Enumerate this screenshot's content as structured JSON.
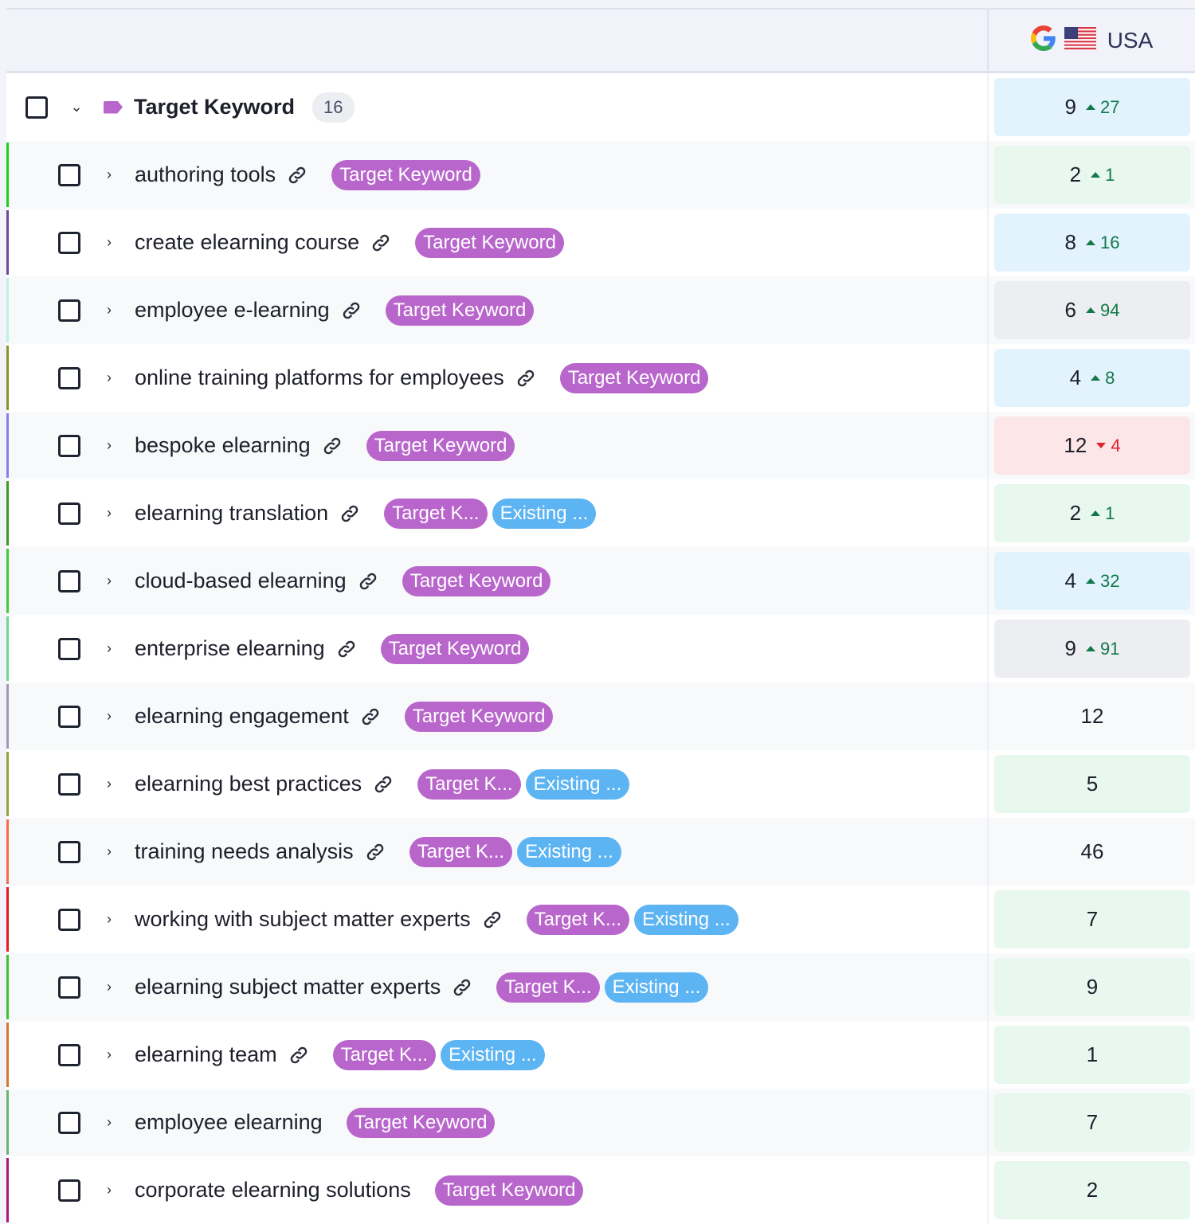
{
  "header": {
    "search_engine_icon": "google-icon",
    "flag_icon": "us-flag-icon",
    "region_label": "USA"
  },
  "group": {
    "name": "Target Keyword",
    "count": "16",
    "position": "9",
    "change": "27",
    "direction": "up",
    "cell_color": "#e3f3fd"
  },
  "colors": {
    "tag_target": "#b866cb",
    "tag_existing": "#5db4f3",
    "up": "#12794a",
    "down": "#e0212b",
    "cell_blue": "#e3f3fd",
    "cell_green": "#e8f8ee",
    "cell_gray": "#eceef1",
    "cell_red": "#fde6e7"
  },
  "rows": [
    {
      "keyword": "authoring tools",
      "link": true,
      "tags": [
        "Target Keyword"
      ],
      "position": "2",
      "change": "1",
      "direction": "up",
      "cell": "#e8f8ee",
      "stripe": "#1bd11b"
    },
    {
      "keyword": "create elearning course",
      "link": true,
      "tags": [
        "Target Keyword"
      ],
      "position": "8",
      "change": "16",
      "direction": "up",
      "cell": "#e3f3fd",
      "stripe": "#6d4a9c"
    },
    {
      "keyword": "employee e-learning",
      "link": true,
      "tags": [
        "Target Keyword"
      ],
      "position": "6",
      "change": "94",
      "direction": "up",
      "cell": "#eceef1",
      "stripe": "#b9f5de"
    },
    {
      "keyword": "online training platforms for employees",
      "link": true,
      "tags": [
        "Target Keyword"
      ],
      "position": "4",
      "change": "8",
      "direction": "up",
      "cell": "#e3f3fd",
      "stripe": "#8a9427"
    },
    {
      "keyword": "bespoke elearning",
      "link": true,
      "tags": [
        "Target Keyword"
      ],
      "position": "12",
      "change": "4",
      "direction": "down",
      "cell": "#fde6e7",
      "stripe": "#8e7af0"
    },
    {
      "keyword": "elearning translation",
      "link": true,
      "tags": [
        "Target K...",
        "Existing ..."
      ],
      "position": "2",
      "change": "1",
      "direction": "up",
      "cell": "#e8f8ee",
      "stripe": "#3f9a1e"
    },
    {
      "keyword": "cloud-based elearning",
      "link": true,
      "tags": [
        "Target Keyword"
      ],
      "position": "4",
      "change": "32",
      "direction": "up",
      "cell": "#e3f3fd",
      "stripe": "#3ccc3c"
    },
    {
      "keyword": "enterprise elearning",
      "link": true,
      "tags": [
        "Target Keyword"
      ],
      "position": "9",
      "change": "91",
      "direction": "up",
      "cell": "#eceef1",
      "stripe": "#6fd98a"
    },
    {
      "keyword": "elearning engagement",
      "link": true,
      "tags": [
        "Target Keyword"
      ],
      "position": "12",
      "change": "",
      "direction": "",
      "cell": "",
      "stripe": "#a298b4"
    },
    {
      "keyword": "elearning best practices",
      "link": true,
      "tags": [
        "Target K...",
        "Existing ..."
      ],
      "position": "5",
      "change": "",
      "direction": "",
      "cell": "#e8f8ee",
      "stripe": "#8fa638"
    },
    {
      "keyword": "training needs analysis",
      "link": true,
      "tags": [
        "Target K...",
        "Existing ..."
      ],
      "position": "46",
      "change": "",
      "direction": "",
      "cell": "",
      "stripe": "#f76c45"
    },
    {
      "keyword": "working with subject matter experts",
      "link": true,
      "tags": [
        "Target K...",
        "Existing ..."
      ],
      "position": "7",
      "change": "",
      "direction": "",
      "cell": "#e8f8ee",
      "stripe": "#e61b1b"
    },
    {
      "keyword": "elearning subject matter experts",
      "link": true,
      "tags": [
        "Target K...",
        "Existing ..."
      ],
      "position": "9",
      "change": "",
      "direction": "",
      "cell": "#e8f8ee",
      "stripe": "#3cc132"
    },
    {
      "keyword": "elearning team",
      "link": true,
      "tags": [
        "Target K...",
        "Existing ..."
      ],
      "position": "1",
      "change": "",
      "direction": "",
      "cell": "#e8f8ee",
      "stripe": "#d7772b"
    },
    {
      "keyword": "employee elearning",
      "link": false,
      "tags": [
        "Target Keyword"
      ],
      "position": "7",
      "change": "",
      "direction": "",
      "cell": "#e8f8ee",
      "stripe": "#6ab56e"
    },
    {
      "keyword": "corporate elearning solutions",
      "link": false,
      "tags": [
        "Target Keyword"
      ],
      "position": "2",
      "change": "",
      "direction": "",
      "cell": "#e8f8ee",
      "stripe": "#b0157a"
    }
  ]
}
